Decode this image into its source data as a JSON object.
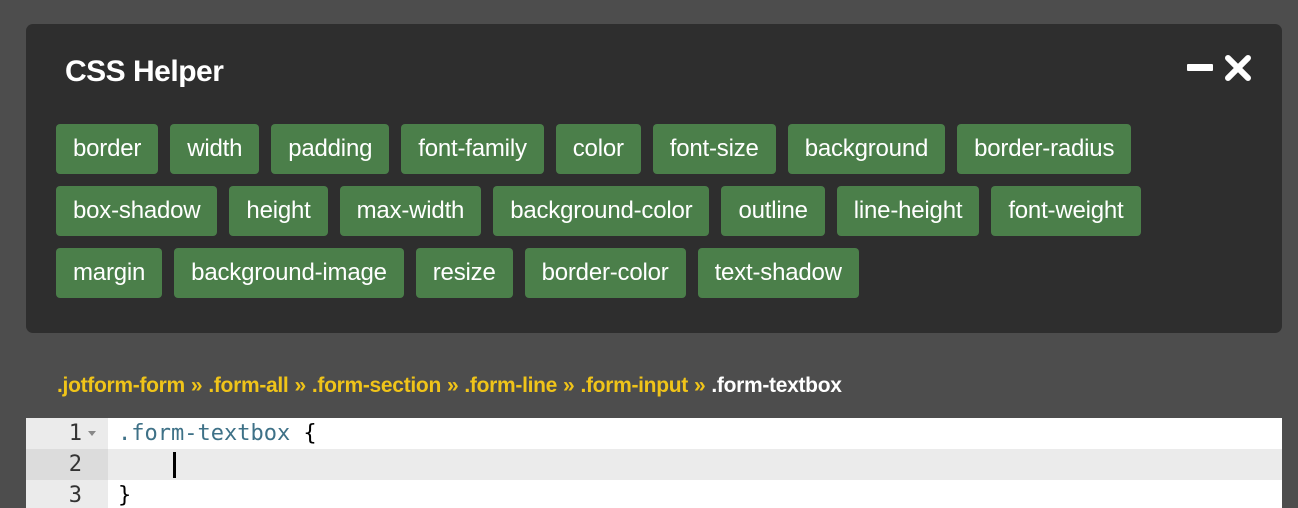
{
  "panel": {
    "title": "CSS Helper",
    "controls": {
      "minimize_icon": "minus-icon",
      "close_icon": "close-icon"
    },
    "property_rows": [
      [
        "border",
        "width",
        "padding",
        "font-family",
        "color",
        "font-size",
        "background",
        "border-radius"
      ],
      [
        "box-shadow",
        "height",
        "max-width",
        "background-color",
        "outline",
        "line-height",
        "font-weight"
      ],
      [
        "margin",
        "background-image",
        "resize",
        "border-color",
        "text-shadow"
      ]
    ]
  },
  "breadcrumb": {
    "items": [
      ".jotform-form",
      ".form-all",
      ".form-section",
      ".form-line",
      ".form-input"
    ],
    "separator": "»",
    "current": ".form-textbox"
  },
  "editor": {
    "lines": [
      {
        "number": "1",
        "selector": ".form-textbox",
        "rest": " {"
      },
      {
        "number": "2",
        "selector": "",
        "rest": ""
      },
      {
        "number": "3",
        "selector": "",
        "rest": "}"
      }
    ],
    "active_line": 2
  },
  "colors": {
    "page_bg": "#4d4d4d",
    "panel_bg": "#2e2e2e",
    "button_bg": "#4b7f4a",
    "breadcrumb_link": "#f0c419",
    "selector_text": "#3e7187"
  }
}
